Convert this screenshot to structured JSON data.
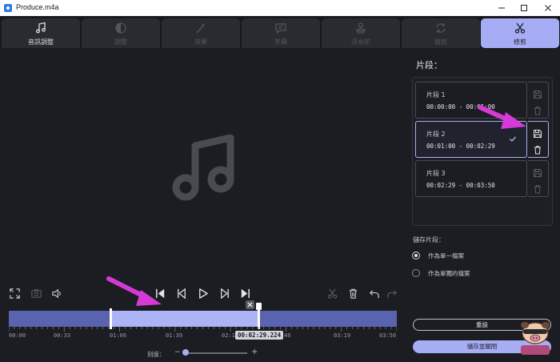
{
  "window": {
    "title": "Produce.m4a"
  },
  "tabs": [
    {
      "label": "音訊調整",
      "icon": "music-note-icon"
    },
    {
      "label": "調整",
      "icon": "contrast-icon"
    },
    {
      "label": "效果",
      "icon": "magic-wand-icon"
    },
    {
      "label": "字幕",
      "icon": "speech-bubble-icon"
    },
    {
      "label": "浮水印",
      "icon": "stamp-icon"
    },
    {
      "label": "裁剪",
      "icon": "crop-rotate-icon"
    },
    {
      "label": "修剪",
      "icon": "scissors-icon"
    }
  ],
  "timeline": {
    "ticks": [
      "00:00",
      "00:33",
      "01:06",
      "01:39",
      "02:1",
      "46",
      "03:19",
      "03:50"
    ],
    "current_time": "00:02:29.224",
    "zoom_label": "刻度：",
    "zoom_minus": "−",
    "zoom_plus": "+"
  },
  "panel": {
    "title": "片段：",
    "segments": [
      {
        "name": "片段 1",
        "range": "00:00:00 - 00:01:00"
      },
      {
        "name": "片段 2",
        "range": "00:01:00 - 00:02:29"
      },
      {
        "name": "片段 3",
        "range": "00:02:29 - 00:03:50"
      }
    ],
    "save_label": "儲存片段：",
    "options": [
      {
        "label": "作為單一檔案"
      },
      {
        "label": "作為單獨的檔案"
      }
    ],
    "reset_label": "重設",
    "save_close_label": "儲存並關閉"
  },
  "colors": {
    "accent": "#a7adf5",
    "timeline": "#5a63b0",
    "annotation_arrow": "#d63ad6"
  }
}
